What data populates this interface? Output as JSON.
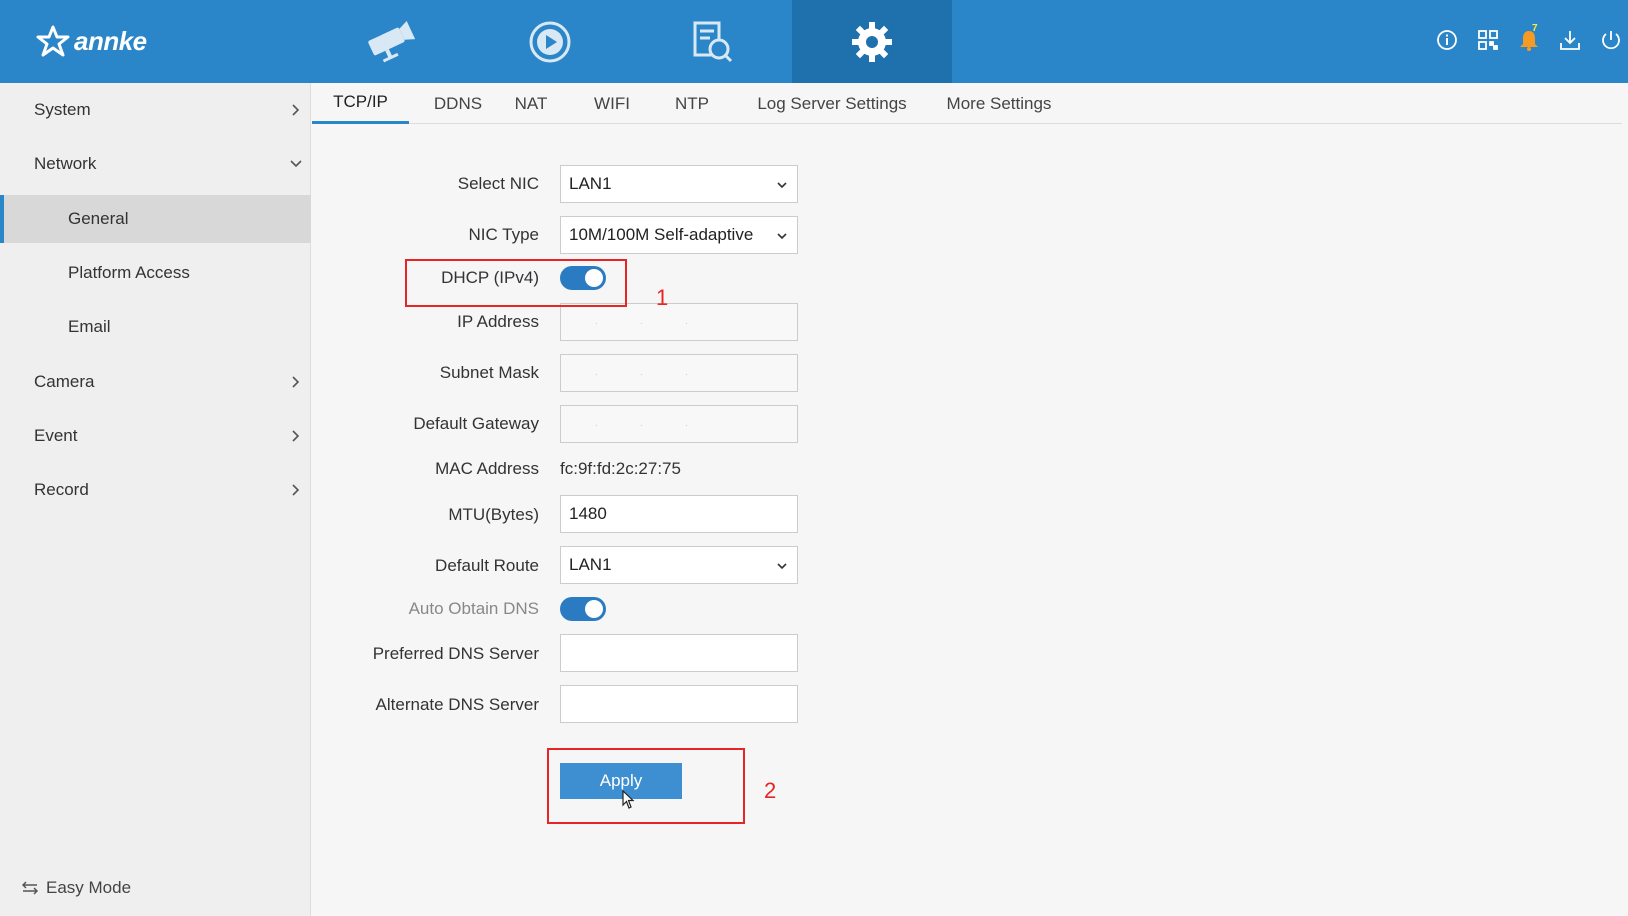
{
  "brand": {
    "name": "annke"
  },
  "topnav": {
    "tabs": [
      {
        "name": "live-view",
        "icon": "camera-icon"
      },
      {
        "name": "playback",
        "icon": "play-circle-icon"
      },
      {
        "name": "search",
        "icon": "file-search-icon"
      },
      {
        "name": "configuration",
        "icon": "gear-icon",
        "active": true
      }
    ],
    "notification_count": "7"
  },
  "sidebar": {
    "items": [
      {
        "label": "System"
      },
      {
        "label": "Network"
      },
      {
        "label": "General"
      },
      {
        "label": "Platform Access"
      },
      {
        "label": "Email"
      },
      {
        "label": "Camera"
      },
      {
        "label": "Event"
      },
      {
        "label": "Record"
      }
    ],
    "easy_mode": "Easy Mode"
  },
  "tabs": [
    "TCP/IP",
    "DDNS",
    "NAT",
    "WIFI",
    "NTP",
    "Log Server Settings",
    "More Settings"
  ],
  "form": {
    "select_nic": {
      "label": "Select NIC",
      "value": "LAN1"
    },
    "nic_type": {
      "label": "NIC Type",
      "value": "10M/100M Self-adaptive"
    },
    "dhcp": {
      "label": "DHCP (IPv4)",
      "enabled": true
    },
    "ip_address": {
      "label": "IP Address"
    },
    "subnet_mask": {
      "label": "Subnet Mask"
    },
    "default_gateway": {
      "label": "Default Gateway"
    },
    "mac_address": {
      "label": "MAC Address",
      "value": "fc:9f:fd:2c:27:75"
    },
    "mtu": {
      "label": "MTU(Bytes)",
      "value": "1480"
    },
    "default_route": {
      "label": "Default Route",
      "value": "LAN1"
    },
    "auto_dns": {
      "label": "Auto Obtain DNS",
      "enabled": true
    },
    "preferred_dns": {
      "label": "Preferred DNS Server",
      "value": ""
    },
    "alternate_dns": {
      "label": "Alternate DNS Server",
      "value": ""
    },
    "apply_label": "Apply"
  },
  "annotations": {
    "step1": "1",
    "step2": "2"
  },
  "colors": {
    "topbar": "#2a86c8",
    "accent": "#2a7bc2",
    "annotation": "#e52626"
  }
}
